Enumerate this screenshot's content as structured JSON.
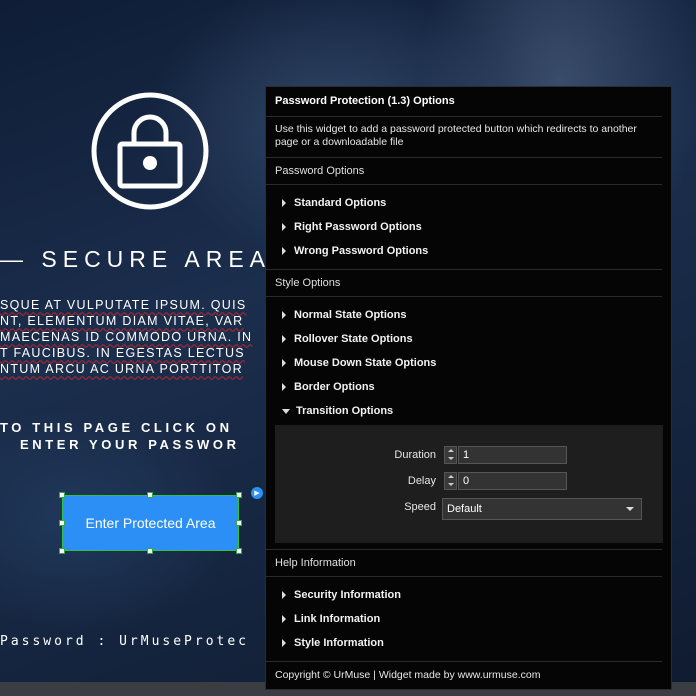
{
  "page": {
    "secure_title": "SECURE AREA",
    "lorem_lines": [
      "SQUE AT VULPUTATE IPSUM. QUIS",
      "NT, ELEMENTUM DIAM VITAE, VAR",
      "MAECENAS ID COMMODO URNA. IN",
      "T FAUCIBUS. IN EGESTAS LECTUS",
      "NTUM ARCU AC URNA PORTTITOR"
    ],
    "instruction_lines": [
      "TO THIS PAGE CLICK ON",
      "ENTER YOUR PASSWOR"
    ],
    "enter_button_label": "Enter Protected Area",
    "password_line": "Password : UrMuseProtec"
  },
  "panel": {
    "title": "Password Protection (1.3) Options",
    "description": "Use this widget to add a password protected button which redirects to another page or a downloadable file",
    "password_section": "Password Options",
    "password_items": [
      "Standard Options",
      "Right Password Options",
      "Wrong Password Options"
    ],
    "style_section": "Style Options",
    "style_items": [
      "Normal State Options",
      "Rollover State Options",
      "Mouse Down State Options",
      "Border Options"
    ],
    "transition": {
      "label": "Transition Options",
      "duration_label": "Duration",
      "duration_value": "1",
      "delay_label": "Delay",
      "delay_value": "0",
      "speed_label": "Speed",
      "speed_value": "Default"
    },
    "help_section": "Help Information",
    "help_items": [
      "Security Information",
      "Link Information",
      "Style Information"
    ],
    "footer": "Copyright © UrMuse | Widget made by www.urmuse.com"
  }
}
